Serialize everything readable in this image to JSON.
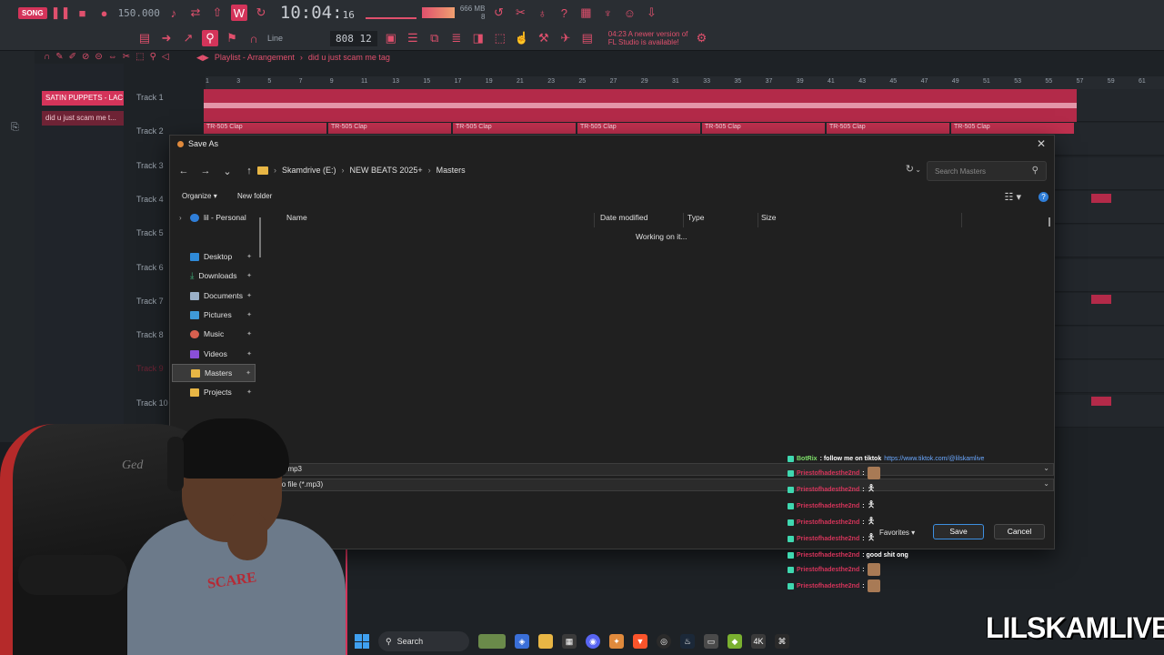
{
  "fl_toolbar": {
    "song_label": "SONG",
    "tempo": "150.000",
    "time": "10:04",
    "time_small": "16",
    "memory": "666 MB",
    "memory_num": "8",
    "line_label": "Line",
    "pattern": "808 12",
    "update_notice_1": "04:23  A newer version of",
    "update_notice_2": "FL Studio is available!"
  },
  "playlist": {
    "title": "Playlist - Arrangement",
    "breadcrumb": "did u just scam me tag",
    "patterns": [
      "SATIN PUPPETS - LAC...",
      "did u just scam me t..."
    ],
    "ruler": [
      "1",
      "3",
      "5",
      "7",
      "9",
      "11",
      "13",
      "15",
      "17",
      "19",
      "21",
      "23",
      "25",
      "27",
      "29",
      "31",
      "33",
      "35",
      "37",
      "39",
      "41",
      "43",
      "45",
      "47",
      "49",
      "51",
      "53",
      "55",
      "57",
      "59",
      "61"
    ],
    "tracks": [
      "Track 1",
      "Track 2",
      "Track 3",
      "Track 4",
      "Track 5",
      "Track 6",
      "Track 7",
      "Track 8",
      "Track 9",
      "Track 10"
    ],
    "clap_label": "TR-505 Clap"
  },
  "dialog": {
    "title": "Save As",
    "close": "✕",
    "path": [
      "Skamdrive (E:)",
      "NEW BEATS 2025+",
      "Masters"
    ],
    "search_placeholder": "Search Masters",
    "organize": "Organize",
    "new_folder": "New folder",
    "nav": [
      {
        "label": "lil - Personal",
        "icon": "cloud-icon"
      },
      {
        "label": "Desktop",
        "icon": "desktop-icon"
      },
      {
        "label": "Downloads",
        "icon": "download-icon"
      },
      {
        "label": "Documents",
        "icon": "documents-icon"
      },
      {
        "label": "Pictures",
        "icon": "pictures-icon"
      },
      {
        "label": "Music",
        "icon": "music-icon"
      },
      {
        "label": "Videos",
        "icon": "videos-icon"
      },
      {
        "label": "Masters",
        "icon": "folder-icon"
      },
      {
        "label": "Projects",
        "icon": "folder-icon"
      }
    ],
    "columns": [
      "Name",
      "Date modified",
      "Type",
      "Size"
    ],
    "status": "Working on it...",
    "file_name": "ct.mp3",
    "file_type": "io file (*.mp3)",
    "favorites": "Favorites",
    "save": "Save",
    "cancel": "Cancel"
  },
  "chat": [
    {
      "user": "BotRix",
      "msg": ": follow me on tiktok",
      "link": "https://www.tiktok.com/@lilskamlive",
      "user_color": "green"
    },
    {
      "user": "Priestofhadesthe2nd",
      "msg": ":",
      "emote": true
    },
    {
      "user": "Priestofhadesthe2nd",
      "msg": ":",
      "figure": "🯅"
    },
    {
      "user": "Priestofhadesthe2nd",
      "msg": ":",
      "figure": "🯅"
    },
    {
      "user": "Priestofhadesthe2nd",
      "msg": ":",
      "figure": "🯅"
    },
    {
      "user": "Priestofhadesthe2nd",
      "msg": ":",
      "figure": "🯅"
    },
    {
      "user": "Priestofhadesthe2nd",
      "msg": ": good shit ong"
    },
    {
      "user": "Priestofhadesthe2nd",
      "msg": ":",
      "emote": true
    },
    {
      "user": "Priestofhadesthe2nd",
      "msg": ":",
      "emote": true
    }
  ],
  "taskbar": {
    "search_label": "Search"
  },
  "webcam": {
    "chair_logo": "Ged",
    "hoodie_print": "SCARE"
  },
  "watermark": "LILSKAMLIVE"
}
